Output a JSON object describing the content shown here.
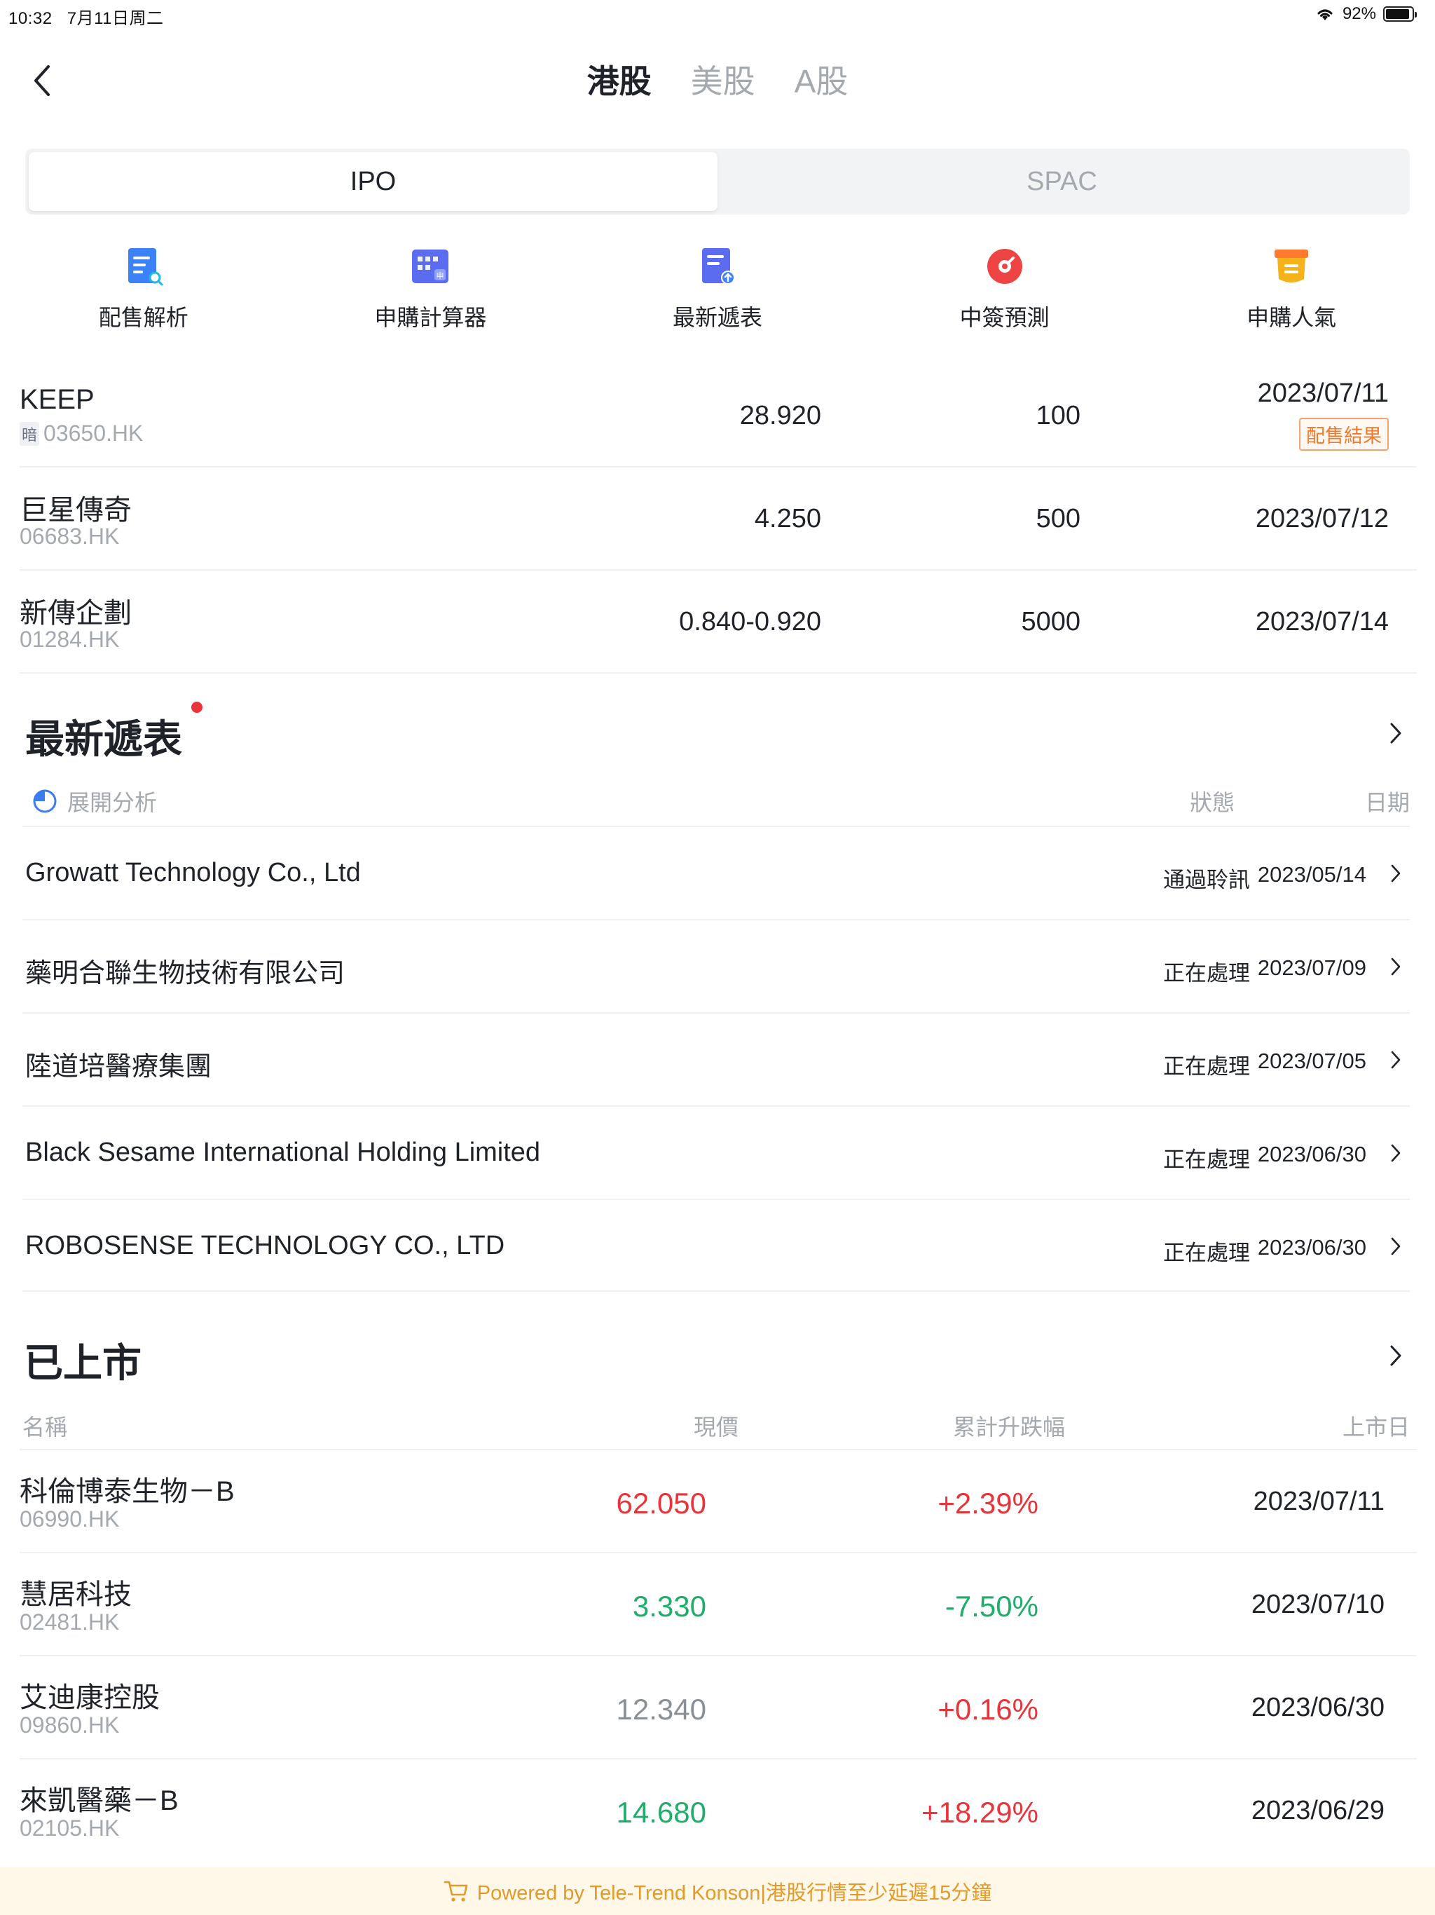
{
  "status_bar": {
    "time": "10:32",
    "date": "7月11日周二",
    "battery": "92%",
    "battery_level": 0.92
  },
  "nav": {
    "tabs": [
      {
        "label": "港股",
        "active": true
      },
      {
        "label": "美股",
        "active": false
      },
      {
        "label": "A股",
        "active": false
      }
    ]
  },
  "segment": {
    "items": [
      "IPO",
      "SPAC"
    ],
    "active": "IPO"
  },
  "tools": [
    {
      "label": "配售解析",
      "icon": "allotment-analysis-icon",
      "color": "#3b82f6"
    },
    {
      "label": "申購計算器",
      "icon": "calculator-icon",
      "color": "#5b6cf0"
    },
    {
      "label": "最新遞表",
      "icon": "latest-filing-icon",
      "color": "#5b6cf0"
    },
    {
      "label": "中簽預測",
      "icon": "lottery-forecast-icon",
      "color": "#ef4444"
    },
    {
      "label": "申購人氣",
      "icon": "subscription-popularity-icon",
      "color": "#f5b21b"
    }
  ],
  "ipo_list": [
    {
      "name": "KEEP",
      "code": "03650.HK",
      "tag": "暗",
      "price": "28.920",
      "lot": "100",
      "date": "2023/07/11",
      "badge": "配售結果"
    },
    {
      "name": "巨星傳奇",
      "code": "06683.HK",
      "tag": "",
      "price": "4.250",
      "lot": "500",
      "date": "2023/07/12",
      "badge": ""
    },
    {
      "name": "新傳企劃",
      "code": "01284.HK",
      "tag": "",
      "price": "0.840-0.920",
      "lot": "5000",
      "date": "2023/07/14",
      "badge": ""
    }
  ],
  "filings": {
    "title": "最新遞表",
    "expand_label": "展開分析",
    "col_status": "狀態",
    "col_date": "日期",
    "rows": [
      {
        "name": "Growatt Technology Co., Ltd",
        "status": "通過聆訊",
        "date": "2023/05/14"
      },
      {
        "name": "藥明合聯生物技術有限公司",
        "status": "正在處理",
        "date": "2023/07/09"
      },
      {
        "name": "陸道培醫療集團",
        "status": "正在處理",
        "date": "2023/07/05"
      },
      {
        "name": "Black Sesame International Holding Limited",
        "status": "正在處理",
        "date": "2023/06/30"
      },
      {
        "name": "ROBOSENSE TECHNOLOGY CO., LTD",
        "status": "正在處理",
        "date": "2023/06/30"
      }
    ]
  },
  "listed": {
    "title": "已上市",
    "col_name": "名稱",
    "col_price": "現價",
    "col_change": "累計升跌幅",
    "col_date": "上市日",
    "rows": [
      {
        "name": "科倫博泰生物－B",
        "code": "06990.HK",
        "price": "62.050",
        "change": "+2.39%",
        "date": "2023/07/11",
        "price_color": "#e8343a",
        "change_color": "#e8343a"
      },
      {
        "name": "慧居科技",
        "code": "02481.HK",
        "price": "3.330",
        "change": "-7.50%",
        "date": "2023/07/10",
        "price_color": "#1fae6a",
        "change_color": "#1fae6a"
      },
      {
        "name": "艾迪康控股",
        "code": "09860.HK",
        "price": "12.340",
        "change": "+0.16%",
        "date": "2023/06/30",
        "price_color": "#8a8f96",
        "change_color": "#e8343a"
      },
      {
        "name": "來凱醫藥－B",
        "code": "02105.HK",
        "price": "14.680",
        "change": "+18.29%",
        "date": "2023/06/29",
        "price_color": "#1fae6a",
        "change_color": "#e8343a"
      }
    ]
  },
  "footer": {
    "text": "Powered by Tele-Trend Konson|港股行情至少延遲15分鐘",
    "icon": "cart-icon"
  },
  "colors": {
    "up": "#e8343a",
    "down": "#1fae6a",
    "flat": "#8a8f96",
    "accent": "#f07a2a"
  }
}
